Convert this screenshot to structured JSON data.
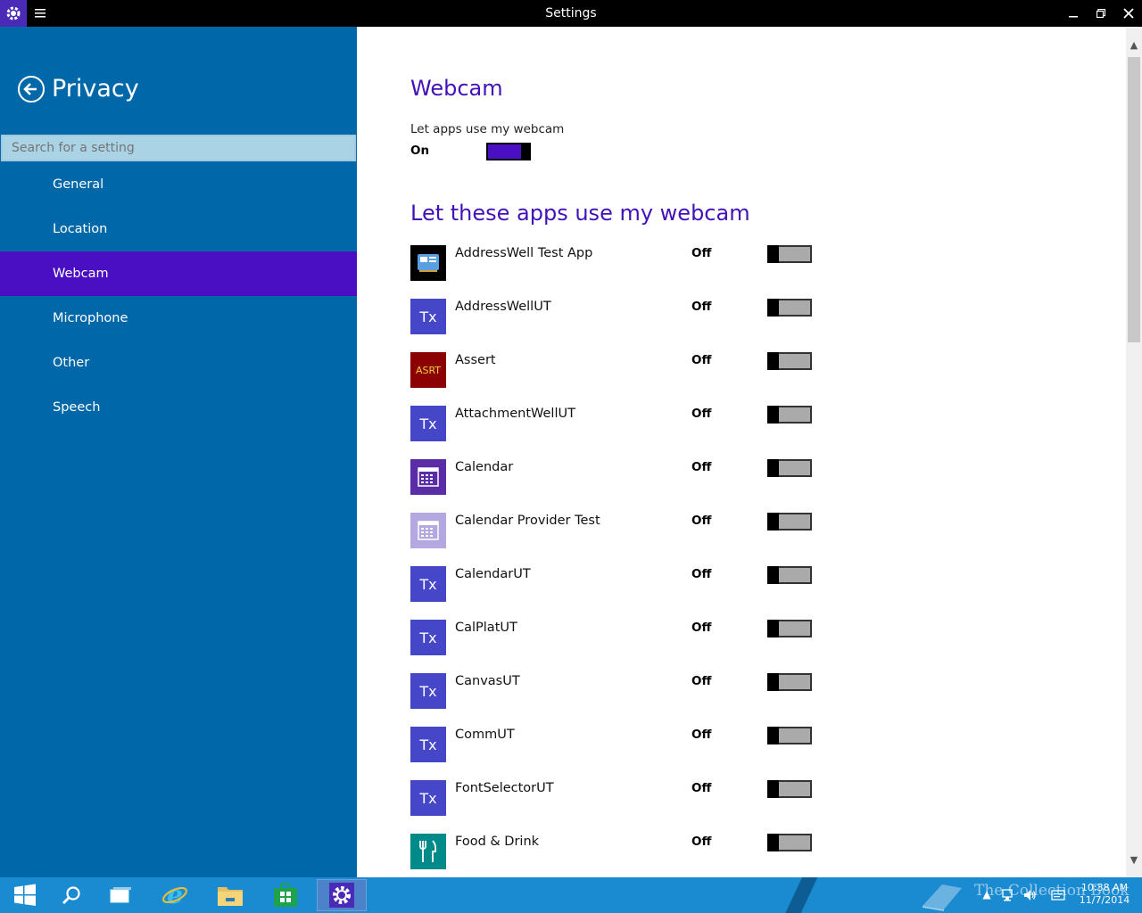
{
  "window": {
    "title": "Settings"
  },
  "sidebar": {
    "title": "Privacy",
    "search_placeholder": "Search for a setting",
    "items": [
      {
        "label": "General",
        "selected": false
      },
      {
        "label": "Location",
        "selected": false
      },
      {
        "label": "Webcam",
        "selected": true
      },
      {
        "label": "Microphone",
        "selected": false
      },
      {
        "label": "Other",
        "selected": false
      },
      {
        "label": "Speech",
        "selected": false
      }
    ]
  },
  "main": {
    "heading": "Webcam",
    "master_toggle": {
      "label": "Let apps use my webcam",
      "state": "On"
    },
    "apps_heading": "Let these apps use my webcam",
    "apps": [
      {
        "name": "AddressWell Test App",
        "state": "Off",
        "icon": "addresswell-test-icon",
        "icon_bg": "#000000",
        "icon_text": ""
      },
      {
        "name": "AddressWellUT",
        "state": "Off",
        "icon": "tx-icon",
        "icon_bg": "#4646c8",
        "icon_text": "Tx"
      },
      {
        "name": "Assert",
        "state": "Off",
        "icon": "asrt-icon",
        "icon_bg": "#8b0000",
        "icon_text": "ASRT"
      },
      {
        "name": "AttachmentWellUT",
        "state": "Off",
        "icon": "tx-icon",
        "icon_bg": "#4646c8",
        "icon_text": "Tx"
      },
      {
        "name": "Calendar",
        "state": "Off",
        "icon": "calendar-icon",
        "icon_bg": "#5a2da6",
        "icon_text": ""
      },
      {
        "name": "Calendar Provider Test",
        "state": "Off",
        "icon": "calendar-icon",
        "icon_bg": "#b5a8e0",
        "icon_text": ""
      },
      {
        "name": "CalendarUT",
        "state": "Off",
        "icon": "tx-icon",
        "icon_bg": "#4646c8",
        "icon_text": "Tx"
      },
      {
        "name": "CalPlatUT",
        "state": "Off",
        "icon": "tx-icon",
        "icon_bg": "#4646c8",
        "icon_text": "Tx"
      },
      {
        "name": "CanvasUT",
        "state": "Off",
        "icon": "tx-icon",
        "icon_bg": "#4646c8",
        "icon_text": "Tx"
      },
      {
        "name": "CommUT",
        "state": "Off",
        "icon": "tx-icon",
        "icon_bg": "#4646c8",
        "icon_text": "Tx"
      },
      {
        "name": "FontSelectorUT",
        "state": "Off",
        "icon": "tx-icon",
        "icon_bg": "#4646c8",
        "icon_text": "Tx"
      },
      {
        "name": "Food & Drink",
        "state": "Off",
        "icon": "food-drink-icon",
        "icon_bg": "#008a8a",
        "icon_text": ""
      }
    ]
  },
  "taskbar": {
    "clock_time": "10:38 AM",
    "clock_date": "11/7/2014",
    "watermark": "The Collection Book"
  },
  "colors": {
    "accent": "#4a0fc2",
    "sidebar_bg": "#0068a8",
    "heading": "#4212b8",
    "taskbar_bg": "#1b8bd1"
  }
}
